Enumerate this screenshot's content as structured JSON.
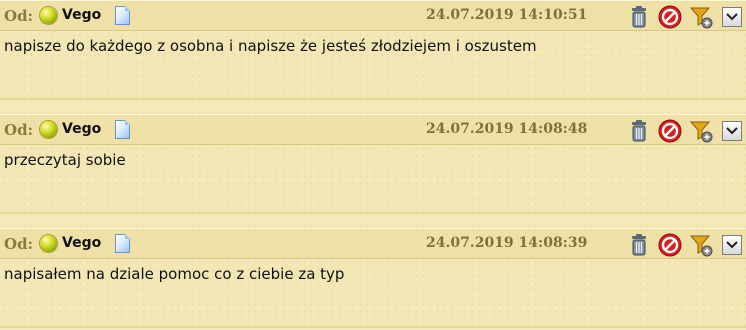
{
  "colors": {
    "background": "#f4e9b8",
    "header": "#eee0a6",
    "timestamp": "#7f6f3a",
    "od_label": "#8c7a3c",
    "status_online": "#a8c41a",
    "block_red": "#d81f1f"
  },
  "messages": [
    {
      "od_label": "Od:",
      "status_icon": "online-status-icon",
      "username": "Vego",
      "profile_icon": "profile-page-icon",
      "timestamp": "24.07.2019 14:10:51",
      "actions": [
        "trash-icon",
        "block-icon",
        "filter-icon",
        "chevron-down-icon"
      ],
      "text": "napisze do każdego z osobna i napisze że jesteś złodziejem i oszustem"
    },
    {
      "od_label": "Od:",
      "status_icon": "online-status-icon",
      "username": "Vego",
      "profile_icon": "profile-page-icon",
      "timestamp": "24.07.2019 14:08:48",
      "actions": [
        "trash-icon",
        "block-icon",
        "filter-icon",
        "chevron-down-icon"
      ],
      "text": "przeczytaj sobie"
    },
    {
      "od_label": "Od:",
      "status_icon": "online-status-icon",
      "username": "Vego",
      "profile_icon": "profile-page-icon",
      "timestamp": "24.07.2019 14:08:39",
      "actions": [
        "trash-icon",
        "block-icon",
        "filter-icon",
        "chevron-down-icon"
      ],
      "text": "napisałem na dziale pomoc co z ciebie za typ"
    }
  ]
}
